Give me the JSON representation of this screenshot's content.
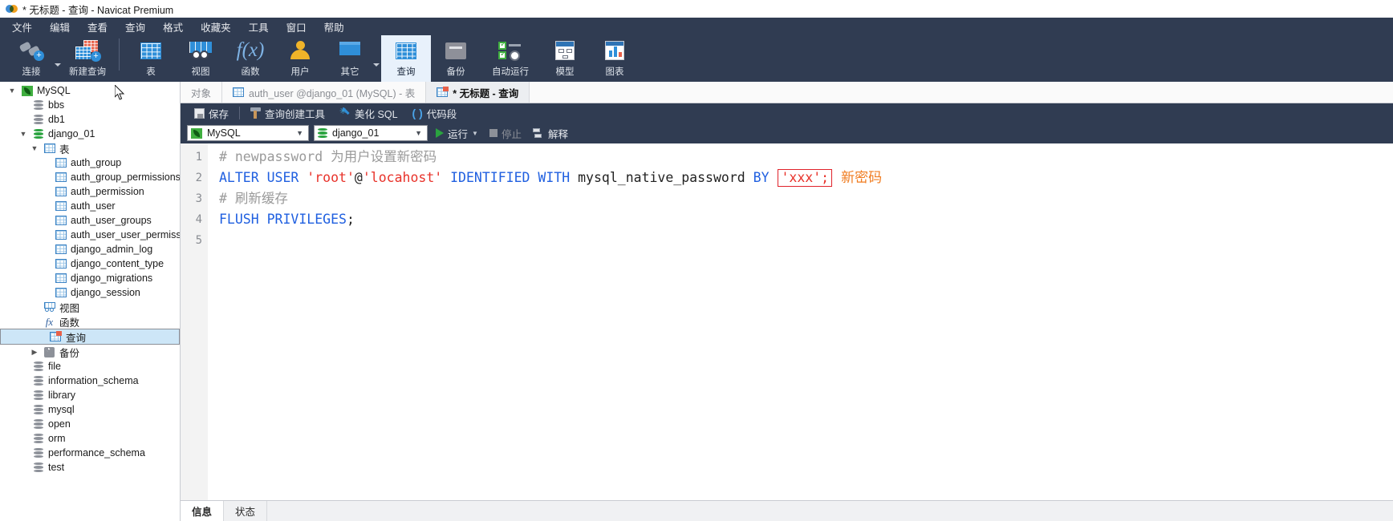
{
  "window": {
    "title": "* 无标题 - 查询 - Navicat Premium",
    "logo_icon": "navicat-logo-icon"
  },
  "menubar": {
    "items": [
      {
        "label": "文件"
      },
      {
        "label": "编辑"
      },
      {
        "label": "查看"
      },
      {
        "label": "查询"
      },
      {
        "label": "格式"
      },
      {
        "label": "收藏夹"
      },
      {
        "label": "工具"
      },
      {
        "label": "窗口"
      },
      {
        "label": "帮助"
      }
    ]
  },
  "toolbar": {
    "items": [
      {
        "label": "连接",
        "icon": "connection-plug-icon",
        "has_caret": true,
        "active": false
      },
      {
        "label": "新建查询",
        "icon": "new-query-icon",
        "has_caret": false,
        "active": false
      },
      {
        "label": "表",
        "icon": "table-grid-icon",
        "has_caret": false,
        "active": false
      },
      {
        "label": "视图",
        "icon": "view-goggles-icon",
        "has_caret": false,
        "active": false
      },
      {
        "label": "函数",
        "icon": "function-fx-icon",
        "has_caret": false,
        "active": false
      },
      {
        "label": "用户",
        "icon": "user-icon",
        "has_caret": false,
        "active": false
      },
      {
        "label": "其它",
        "icon": "other-drawer-icon",
        "has_caret": true,
        "active": false
      },
      {
        "label": "查询",
        "icon": "query-grid-icon",
        "has_caret": false,
        "active": true
      },
      {
        "label": "备份",
        "icon": "backup-icon",
        "has_caret": false,
        "active": false
      },
      {
        "label": "自动运行",
        "icon": "automation-clock-icon",
        "has_caret": false,
        "active": false
      },
      {
        "label": "模型",
        "icon": "model-diagram-icon",
        "has_caret": false,
        "active": false
      },
      {
        "label": "图表",
        "icon": "chart-icon",
        "has_caret": false,
        "active": false
      }
    ]
  },
  "sidebar": {
    "nodes": [
      {
        "label": "MySQL",
        "depth": 0,
        "icon": "mysql-connection-icon",
        "chevron": "down",
        "selected": false
      },
      {
        "label": "bbs",
        "depth": 1,
        "icon": "database-icon",
        "chevron": "none",
        "selected": false
      },
      {
        "label": "db1",
        "depth": 1,
        "icon": "database-icon",
        "chevron": "none",
        "selected": false
      },
      {
        "label": "django_01",
        "depth": 1,
        "icon": "database-open-icon",
        "chevron": "down",
        "selected": false
      },
      {
        "label": "表",
        "depth": 2,
        "icon": "tables-folder-icon",
        "chevron": "down",
        "selected": false
      },
      {
        "label": "auth_group",
        "depth": 3,
        "icon": "table-icon",
        "chevron": "none",
        "selected": false
      },
      {
        "label": "auth_group_permissions",
        "depth": 3,
        "icon": "table-icon",
        "chevron": "none",
        "selected": false
      },
      {
        "label": "auth_permission",
        "depth": 3,
        "icon": "table-icon",
        "chevron": "none",
        "selected": false
      },
      {
        "label": "auth_user",
        "depth": 3,
        "icon": "table-icon",
        "chevron": "none",
        "selected": false
      },
      {
        "label": "auth_user_groups",
        "depth": 3,
        "icon": "table-icon",
        "chevron": "none",
        "selected": false
      },
      {
        "label": "auth_user_user_permissions",
        "depth": 3,
        "icon": "table-icon",
        "chevron": "none",
        "selected": false
      },
      {
        "label": "django_admin_log",
        "depth": 3,
        "icon": "table-icon",
        "chevron": "none",
        "selected": false
      },
      {
        "label": "django_content_type",
        "depth": 3,
        "icon": "table-icon",
        "chevron": "none",
        "selected": false
      },
      {
        "label": "django_migrations",
        "depth": 3,
        "icon": "table-icon",
        "chevron": "none",
        "selected": false
      },
      {
        "label": "django_session",
        "depth": 3,
        "icon": "table-icon",
        "chevron": "none",
        "selected": false
      },
      {
        "label": "视图",
        "depth": 2,
        "icon": "view-icon",
        "chevron": "none",
        "selected": false
      },
      {
        "label": "函数",
        "depth": 2,
        "icon": "function-icon",
        "chevron": "none",
        "selected": false
      },
      {
        "label": "查询",
        "depth": 2,
        "icon": "query-icon",
        "chevron": "none",
        "selected": true
      },
      {
        "label": "备份",
        "depth": 2,
        "icon": "backup-icon",
        "chevron": "right",
        "selected": false
      },
      {
        "label": "file",
        "depth": 1,
        "icon": "database-icon",
        "chevron": "none",
        "selected": false
      },
      {
        "label": "information_schema",
        "depth": 1,
        "icon": "database-icon",
        "chevron": "none",
        "selected": false
      },
      {
        "label": "library",
        "depth": 1,
        "icon": "database-icon",
        "chevron": "none",
        "selected": false
      },
      {
        "label": "mysql",
        "depth": 1,
        "icon": "database-icon",
        "chevron": "none",
        "selected": false
      },
      {
        "label": "open",
        "depth": 1,
        "icon": "database-icon",
        "chevron": "none",
        "selected": false
      },
      {
        "label": "orm",
        "depth": 1,
        "icon": "database-icon",
        "chevron": "none",
        "selected": false
      },
      {
        "label": "performance_schema",
        "depth": 1,
        "icon": "database-icon",
        "chevron": "none",
        "selected": false
      },
      {
        "label": "test",
        "depth": 1,
        "icon": "database-icon",
        "chevron": "none",
        "selected": false
      }
    ]
  },
  "tabs": [
    {
      "label": "对象",
      "icon": "none",
      "state": "inactive"
    },
    {
      "label": "auth_user @django_01 (MySQL) - 表",
      "icon": "table-icon",
      "state": "inactive"
    },
    {
      "label": "* 无标题 - 查询",
      "icon": "query-icon",
      "state": "current"
    }
  ],
  "query_toolbar": {
    "save_label": "保存",
    "save_icon": "save-icon",
    "builder_label": "查询创建工具",
    "builder_icon": "hammer-icon",
    "beautify_label": "美化 SQL",
    "beautify_icon": "wand-icon",
    "snippet_label": "代码段",
    "snippet_icon": "parenthesis-icon"
  },
  "connection_bar": {
    "server_value": "MySQL",
    "server_icon": "mysql-leaf-icon",
    "database_value": "django_01",
    "database_icon": "database-green-icon",
    "run_label": "运行",
    "run_icon": "play-icon",
    "run_caret_icon": "chevron-down-icon",
    "stop_label": "停止",
    "stop_icon": "stop-square-icon",
    "explain_label": "解释",
    "explain_icon": "explain-icon"
  },
  "editor": {
    "line_numbers": [
      "1",
      "2",
      "3",
      "4",
      "5"
    ],
    "lines": [
      {
        "num": "1",
        "tokens": [
          {
            "t": "# newpassword 为用户设置新密码",
            "c": "cmt"
          }
        ]
      },
      {
        "num": "2",
        "tokens": [
          {
            "t": "ALTER",
            "c": "kw"
          },
          {
            "t": " ",
            "c": "pln"
          },
          {
            "t": "USER",
            "c": "kw"
          },
          {
            "t": " ",
            "c": "pln"
          },
          {
            "t": "'root'",
            "c": "str"
          },
          {
            "t": "@",
            "c": "op"
          },
          {
            "t": "'locahost'",
            "c": "str"
          },
          {
            "t": " ",
            "c": "pln"
          },
          {
            "t": "IDENTIFIED",
            "c": "kw"
          },
          {
            "t": " ",
            "c": "pln"
          },
          {
            "t": "WITH",
            "c": "kw"
          },
          {
            "t": " ",
            "c": "pln"
          },
          {
            "t": "mysql_native_password",
            "c": "pln"
          },
          {
            "t": " ",
            "c": "pln"
          },
          {
            "t": "BY",
            "c": "kw"
          },
          {
            "t": " ",
            "c": "pln"
          }
        ],
        "boxed": "'xxx';",
        "annotation": "新密码"
      },
      {
        "num": "3",
        "tokens": [
          {
            "t": "# 刷新缓存",
            "c": "cmt"
          }
        ]
      },
      {
        "num": "4",
        "tokens": [
          {
            "t": "FLUSH",
            "c": "kw"
          },
          {
            "t": " ",
            "c": "pln"
          },
          {
            "t": "PRIVILEGES",
            "c": "kw"
          },
          {
            "t": ";",
            "c": "op"
          }
        ]
      },
      {
        "num": "5",
        "tokens": []
      }
    ],
    "annotation_box_color": "#e0222a",
    "annotation_text_color": "#f07c20"
  },
  "bottom_tabs": [
    {
      "label": "信息",
      "active": true
    },
    {
      "label": "状态",
      "active": false
    }
  ],
  "colors": {
    "chrome": "#303c52",
    "accent_blue": "#2f8fd9",
    "keyword": "#1f5fe0",
    "string": "#e8322a",
    "comment": "#9a9a9a",
    "selection": "#cde6f7"
  }
}
